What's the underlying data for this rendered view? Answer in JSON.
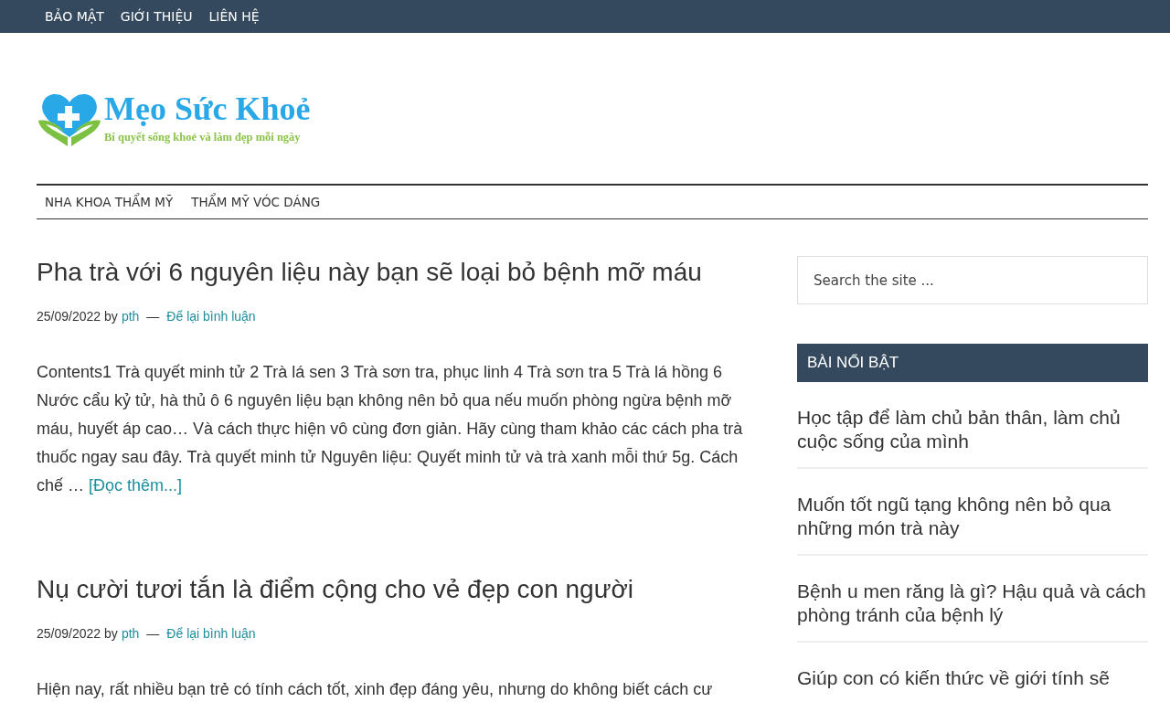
{
  "top_menu": [
    "BẢO MẬT",
    "GIỚI THIỆU",
    "LIÊN HỆ"
  ],
  "logo": {
    "title": "Mẹo Sức Khoẻ",
    "tagline": "Bí quyết sống khoẻ và làm đẹp mỗi ngày"
  },
  "main_menu": [
    "NHA KHOA THẨM MỸ",
    "THẨM MỸ VÓC DÁNG"
  ],
  "posts": [
    {
      "title": "Pha trà với 6 nguyên liệu này bạn sẽ loại bỏ bệnh mỡ máu",
      "date": "25/09/2022",
      "by": "by",
      "author": "pth",
      "separator": "—",
      "comments": "Để lại bình luận",
      "excerpt": "Contents1 Trà quyết minh tử 2 Trà lá sen 3 Trà sơn tra, phục linh 4 Trà sơn tra 5 Trà lá hồng 6 Nước cẩu kỷ tử, hà thủ ô  6 nguyên liệu bạn không nên bỏ qua nếu muốn phòng ngừa bệnh mỡ máu, huyết áp cao… Và cách thực hiện vô cùng đơn giản. Hãy cùng tham khảo các cách pha trà thuốc ngay sau đây. Trà quyết minh tử  Nguyên liệu: Quyết minh tử và trà xanh mỗi thứ 5g. Cách chế …",
      "read_more": "[Đọc thêm...]"
    },
    {
      "title": "Nụ cười tươi tắn là điểm cộng cho vẻ đẹp con người",
      "date": "25/09/2022",
      "by": "by",
      "author": "pth",
      "separator": "—",
      "comments": "Để lại bình luận",
      "excerpt": "Hiện nay, rất nhiều bạn trẻ có tính cách tốt, xinh đẹp đáng yêu, nhưng do không biết cách cư"
    }
  ],
  "sidebar": {
    "search": {
      "placeholder": "Search the site ..."
    },
    "featured": {
      "title": "BÀI NỔI BẬT",
      "items": [
        "Học tập để làm chủ bản thân, làm chủ cuộc sống của mình",
        "Muốn tốt ngũ tạng không nên bỏ qua những món trà này",
        "Bệnh u men răng là gì? Hậu quả và cách phòng tránh của bệnh lý",
        "Giúp con có kiến thức về giới tính sẽ"
      ]
    }
  }
}
